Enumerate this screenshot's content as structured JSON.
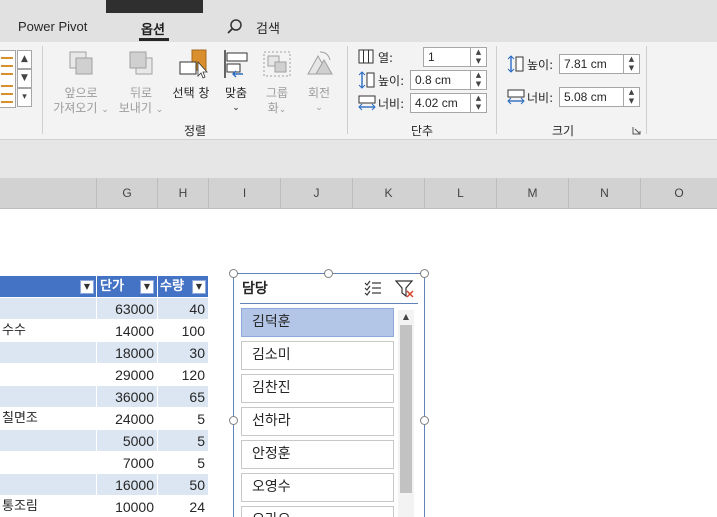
{
  "tabs": {
    "power_pivot": "Power Pivot",
    "options": "옵션",
    "search": "검색"
  },
  "ribbon": {
    "bring_forward": {
      "line1": "앞으로",
      "line2": "가져오기"
    },
    "send_backward": {
      "line1": "뒤로",
      "line2": "보내기"
    },
    "selection_pane": {
      "label": "선택 창"
    },
    "align": {
      "label": "맞춤"
    },
    "group": {
      "line1": "그룹",
      "line2": "화"
    },
    "rotate": {
      "label": "회전"
    },
    "arrange_group_label": "정렬",
    "buttons_group": {
      "columns_label": "열:",
      "columns_value": "1",
      "height_label": "높이:",
      "height_value": "0.8 cm",
      "width_label": "너비:",
      "width_value": "4.02 cm",
      "group_label": "단추"
    },
    "size_group": {
      "height_label": "높이:",
      "height_value": "7.81 cm",
      "width_label": "너비:",
      "width_value": "5.08 cm",
      "group_label": "크기"
    }
  },
  "columns": [
    "G",
    "H",
    "I",
    "J",
    "K",
    "L",
    "M",
    "N",
    "O"
  ],
  "table": {
    "headers": {
      "price": "단가",
      "qty": "수량"
    },
    "rows": [
      {
        "text": "",
        "price": "63000",
        "qty": "40"
      },
      {
        "text": "수수",
        "price": "14000",
        "qty": "100"
      },
      {
        "text": "",
        "price": "18000",
        "qty": "30"
      },
      {
        "text": "",
        "price": "29000",
        "qty": "120"
      },
      {
        "text": "",
        "price": "36000",
        "qty": "65"
      },
      {
        "text": "칠면조",
        "price": "24000",
        "qty": "5"
      },
      {
        "text": "",
        "price": "5000",
        "qty": "5"
      },
      {
        "text": "",
        "price": "7000",
        "qty": "5"
      },
      {
        "text": "",
        "price": "16000",
        "qty": "50"
      },
      {
        "text": "통조림",
        "price": "10000",
        "qty": "24"
      }
    ]
  },
  "slicer": {
    "title": "담당",
    "items": [
      {
        "label": "김덕훈",
        "selected": true
      },
      {
        "label": "김소미",
        "selected": false
      },
      {
        "label": "김찬진",
        "selected": false
      },
      {
        "label": "선하라",
        "selected": false
      },
      {
        "label": "안정훈",
        "selected": false
      },
      {
        "label": "오영수",
        "selected": false
      },
      {
        "label": "오라오",
        "selected": false
      }
    ]
  },
  "colors": {
    "table_header": "#4472c4",
    "row_band": "#dce6f2",
    "row_band_alt": "#ffffff",
    "slicer_selected": "#b4c6e7",
    "accent_orange": "#d98f2d"
  }
}
